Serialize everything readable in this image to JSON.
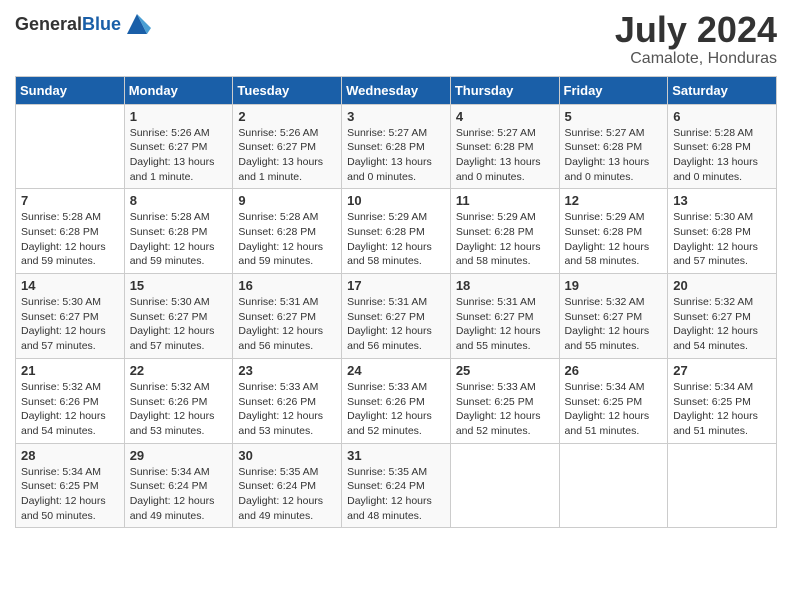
{
  "header": {
    "logo_general": "General",
    "logo_blue": "Blue",
    "month_year": "July 2024",
    "location": "Camalote, Honduras"
  },
  "weekdays": [
    "Sunday",
    "Monday",
    "Tuesday",
    "Wednesday",
    "Thursday",
    "Friday",
    "Saturday"
  ],
  "weeks": [
    [
      {
        "day": "",
        "sunrise": "",
        "sunset": "",
        "daylight": ""
      },
      {
        "day": "1",
        "sunrise": "Sunrise: 5:26 AM",
        "sunset": "Sunset: 6:27 PM",
        "daylight": "Daylight: 13 hours and 1 minute."
      },
      {
        "day": "2",
        "sunrise": "Sunrise: 5:26 AM",
        "sunset": "Sunset: 6:27 PM",
        "daylight": "Daylight: 13 hours and 1 minute."
      },
      {
        "day": "3",
        "sunrise": "Sunrise: 5:27 AM",
        "sunset": "Sunset: 6:28 PM",
        "daylight": "Daylight: 13 hours and 0 minutes."
      },
      {
        "day": "4",
        "sunrise": "Sunrise: 5:27 AM",
        "sunset": "Sunset: 6:28 PM",
        "daylight": "Daylight: 13 hours and 0 minutes."
      },
      {
        "day": "5",
        "sunrise": "Sunrise: 5:27 AM",
        "sunset": "Sunset: 6:28 PM",
        "daylight": "Daylight: 13 hours and 0 minutes."
      },
      {
        "day": "6",
        "sunrise": "Sunrise: 5:28 AM",
        "sunset": "Sunset: 6:28 PM",
        "daylight": "Daylight: 13 hours and 0 minutes."
      }
    ],
    [
      {
        "day": "7",
        "sunrise": "Sunrise: 5:28 AM",
        "sunset": "Sunset: 6:28 PM",
        "daylight": "Daylight: 12 hours and 59 minutes."
      },
      {
        "day": "8",
        "sunrise": "Sunrise: 5:28 AM",
        "sunset": "Sunset: 6:28 PM",
        "daylight": "Daylight: 12 hours and 59 minutes."
      },
      {
        "day": "9",
        "sunrise": "Sunrise: 5:28 AM",
        "sunset": "Sunset: 6:28 PM",
        "daylight": "Daylight: 12 hours and 59 minutes."
      },
      {
        "day": "10",
        "sunrise": "Sunrise: 5:29 AM",
        "sunset": "Sunset: 6:28 PM",
        "daylight": "Daylight: 12 hours and 58 minutes."
      },
      {
        "day": "11",
        "sunrise": "Sunrise: 5:29 AM",
        "sunset": "Sunset: 6:28 PM",
        "daylight": "Daylight: 12 hours and 58 minutes."
      },
      {
        "day": "12",
        "sunrise": "Sunrise: 5:29 AM",
        "sunset": "Sunset: 6:28 PM",
        "daylight": "Daylight: 12 hours and 58 minutes."
      },
      {
        "day": "13",
        "sunrise": "Sunrise: 5:30 AM",
        "sunset": "Sunset: 6:28 PM",
        "daylight": "Daylight: 12 hours and 57 minutes."
      }
    ],
    [
      {
        "day": "14",
        "sunrise": "Sunrise: 5:30 AM",
        "sunset": "Sunset: 6:27 PM",
        "daylight": "Daylight: 12 hours and 57 minutes."
      },
      {
        "day": "15",
        "sunrise": "Sunrise: 5:30 AM",
        "sunset": "Sunset: 6:27 PM",
        "daylight": "Daylight: 12 hours and 57 minutes."
      },
      {
        "day": "16",
        "sunrise": "Sunrise: 5:31 AM",
        "sunset": "Sunset: 6:27 PM",
        "daylight": "Daylight: 12 hours and 56 minutes."
      },
      {
        "day": "17",
        "sunrise": "Sunrise: 5:31 AM",
        "sunset": "Sunset: 6:27 PM",
        "daylight": "Daylight: 12 hours and 56 minutes."
      },
      {
        "day": "18",
        "sunrise": "Sunrise: 5:31 AM",
        "sunset": "Sunset: 6:27 PM",
        "daylight": "Daylight: 12 hours and 55 minutes."
      },
      {
        "day": "19",
        "sunrise": "Sunrise: 5:32 AM",
        "sunset": "Sunset: 6:27 PM",
        "daylight": "Daylight: 12 hours and 55 minutes."
      },
      {
        "day": "20",
        "sunrise": "Sunrise: 5:32 AM",
        "sunset": "Sunset: 6:27 PM",
        "daylight": "Daylight: 12 hours and 54 minutes."
      }
    ],
    [
      {
        "day": "21",
        "sunrise": "Sunrise: 5:32 AM",
        "sunset": "Sunset: 6:26 PM",
        "daylight": "Daylight: 12 hours and 54 minutes."
      },
      {
        "day": "22",
        "sunrise": "Sunrise: 5:32 AM",
        "sunset": "Sunset: 6:26 PM",
        "daylight": "Daylight: 12 hours and 53 minutes."
      },
      {
        "day": "23",
        "sunrise": "Sunrise: 5:33 AM",
        "sunset": "Sunset: 6:26 PM",
        "daylight": "Daylight: 12 hours and 53 minutes."
      },
      {
        "day": "24",
        "sunrise": "Sunrise: 5:33 AM",
        "sunset": "Sunset: 6:26 PM",
        "daylight": "Daylight: 12 hours and 52 minutes."
      },
      {
        "day": "25",
        "sunrise": "Sunrise: 5:33 AM",
        "sunset": "Sunset: 6:25 PM",
        "daylight": "Daylight: 12 hours and 52 minutes."
      },
      {
        "day": "26",
        "sunrise": "Sunrise: 5:34 AM",
        "sunset": "Sunset: 6:25 PM",
        "daylight": "Daylight: 12 hours and 51 minutes."
      },
      {
        "day": "27",
        "sunrise": "Sunrise: 5:34 AM",
        "sunset": "Sunset: 6:25 PM",
        "daylight": "Daylight: 12 hours and 51 minutes."
      }
    ],
    [
      {
        "day": "28",
        "sunrise": "Sunrise: 5:34 AM",
        "sunset": "Sunset: 6:25 PM",
        "daylight": "Daylight: 12 hours and 50 minutes."
      },
      {
        "day": "29",
        "sunrise": "Sunrise: 5:34 AM",
        "sunset": "Sunset: 6:24 PM",
        "daylight": "Daylight: 12 hours and 49 minutes."
      },
      {
        "day": "30",
        "sunrise": "Sunrise: 5:35 AM",
        "sunset": "Sunset: 6:24 PM",
        "daylight": "Daylight: 12 hours and 49 minutes."
      },
      {
        "day": "31",
        "sunrise": "Sunrise: 5:35 AM",
        "sunset": "Sunset: 6:24 PM",
        "daylight": "Daylight: 12 hours and 48 minutes."
      },
      {
        "day": "",
        "sunrise": "",
        "sunset": "",
        "daylight": ""
      },
      {
        "day": "",
        "sunrise": "",
        "sunset": "",
        "daylight": ""
      },
      {
        "day": "",
        "sunrise": "",
        "sunset": "",
        "daylight": ""
      }
    ]
  ]
}
